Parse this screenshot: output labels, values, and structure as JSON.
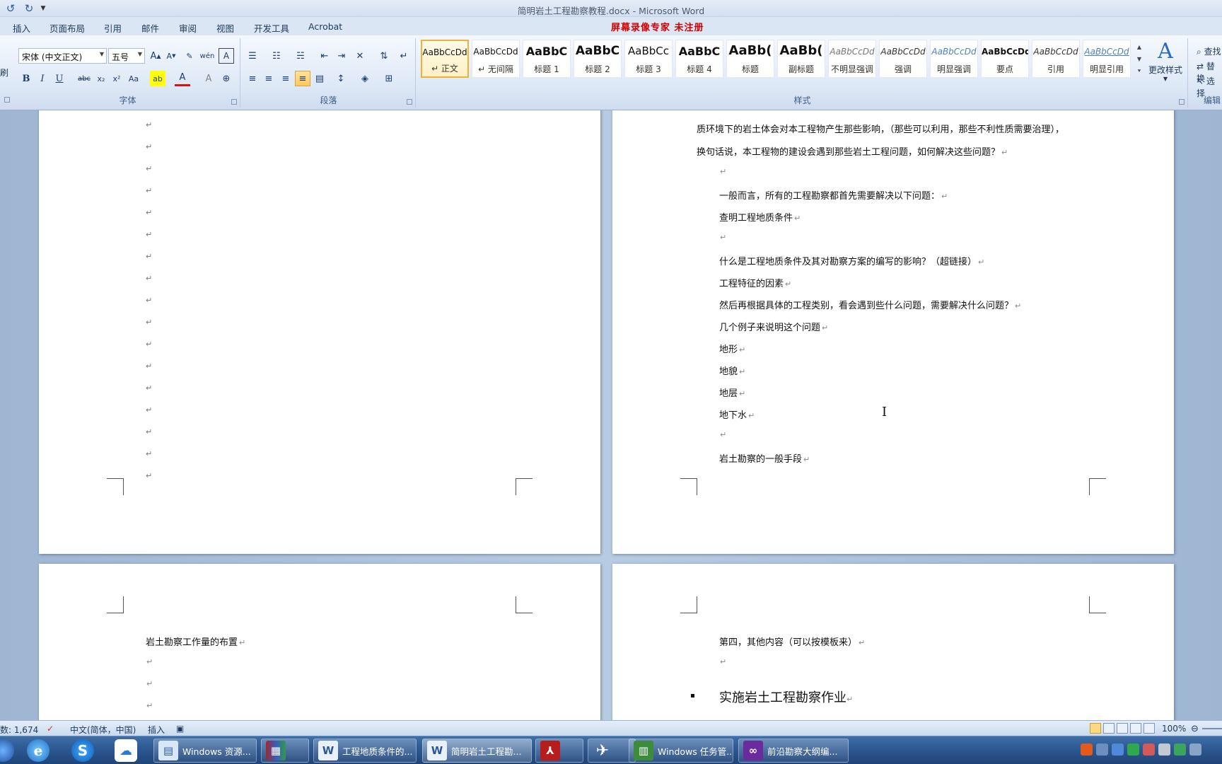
{
  "window": {
    "title": "简明岩土工程勘察教程.docx - Microsoft Word"
  },
  "tabs": [
    "插入",
    "页面布局",
    "引用",
    "邮件",
    "审阅",
    "视图",
    "开发工具",
    "Acrobat"
  ],
  "banner": "屏幕录像专家  未注册",
  "ribbon": {
    "font_name": "宋体 (中文正文)",
    "font_size": "五号",
    "font_group": "字体",
    "paragraph_group": "段落",
    "styles_group": "样式",
    "change_styles": "更改样式",
    "editing_group": "编辑",
    "editing_items": [
      "查找",
      "替换",
      "选择"
    ],
    "clipboard_partial": "刷",
    "styles": [
      {
        "sample": "AaBbCcDd",
        "name": "↵ 正文"
      },
      {
        "sample": "AaBbCcDd",
        "name": "↵ 无间隔"
      },
      {
        "sample": "AaBbC",
        "name": "标题 1"
      },
      {
        "sample": "AaBbC",
        "name": "标题 2"
      },
      {
        "sample": "AaBbCc",
        "name": "标题 3"
      },
      {
        "sample": "AaBbC",
        "name": "标题 4"
      },
      {
        "sample": "AaBb(",
        "name": "标题"
      },
      {
        "sample": "AaBb(",
        "name": "副标题"
      },
      {
        "sample": "AaBbCcDd",
        "name": "不明显强调"
      },
      {
        "sample": "AaBbCcDd",
        "name": "强调"
      },
      {
        "sample": "AaBbCcDd",
        "name": "明显强调"
      },
      {
        "sample": "AaBbCcDd",
        "name": "要点"
      },
      {
        "sample": "AaBbCcDd",
        "name": "引用"
      },
      {
        "sample": "AaBbCcDd",
        "name": "明显引用"
      }
    ]
  },
  "document": {
    "page2_lines": [
      "质环境下的岩土体会对本工程物产生那些影响，（那些可以利用，那些不利性质需要治理），",
      "换句话说，本工程物的建设会遇到那些岩土工程问题，如何解决这些问题？",
      "",
      "一般而言，所有的工程勘察都首先需要解决以下问题：",
      "查明工程地质条件",
      "",
      "什么是工程地质条件及其对勘察方案的编写的影响？（超链接）",
      "工程特征的因素",
      "然后再根据具体的工程类别，看会遇到些什么问题，需要解决什么问题？",
      "几个例子来说明这个问题",
      "地形",
      "地貌",
      "地层",
      "地下水",
      "",
      "岩土勘察的一般手段"
    ],
    "page3_lines": [
      "岩土勘察工作量的布置",
      "",
      "",
      ""
    ],
    "page4_lines": [
      "第四，其他内容（可以按模板来）",
      ""
    ],
    "page4_heading": "实施岩土工程勘察作业"
  },
  "status": {
    "word_count": "数: 1,674",
    "language": "中文(简体，中国)",
    "mode": "插入",
    "zoom": "100%"
  },
  "taskbar": {
    "items": [
      {
        "label": "Windows 资源..."
      },
      {
        "label": "工程地质条件的..."
      },
      {
        "label": "简明岩土工程勘..."
      },
      {
        "label": "Windows 任务管..."
      },
      {
        "label": "前沿勘察大纲编..."
      }
    ]
  },
  "colors": {
    "banner": "#d40000",
    "selected_style": "#f0b13b",
    "taskbar": "#2d5891"
  }
}
